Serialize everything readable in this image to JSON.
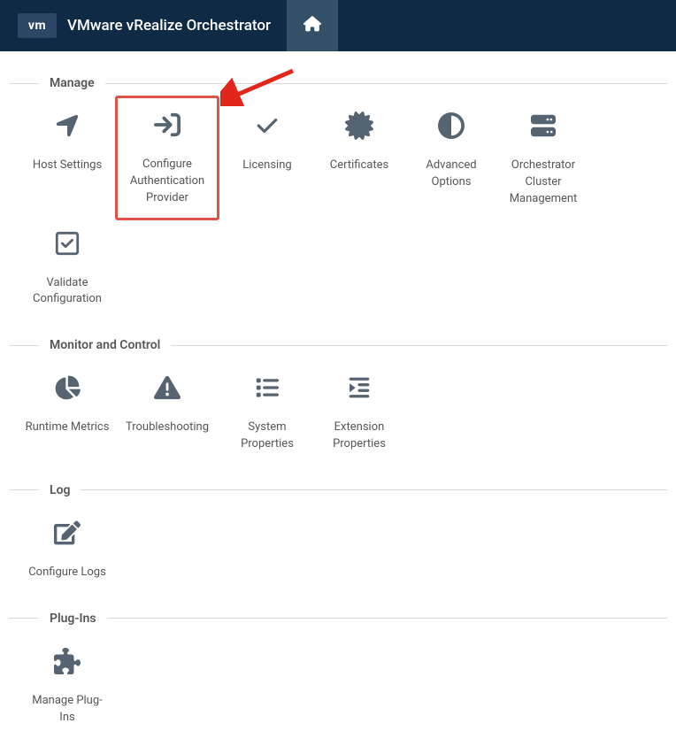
{
  "header": {
    "logo_text": "vm",
    "title": "VMware vRealize Orchestrator"
  },
  "sections": {
    "manage": {
      "title": "Manage",
      "tiles": {
        "host_settings": "Host Settings",
        "config_auth": "Configure Authentication Provider",
        "licensing": "Licensing",
        "certificates": "Certificates",
        "advanced_options": "Advanced Options",
        "orchestrator_cluster": "Orchestrator Cluster Management",
        "validate_config": "Validate Configuration"
      }
    },
    "monitor": {
      "title": "Monitor and Control",
      "tiles": {
        "runtime_metrics": "Runtime Metrics",
        "troubleshooting": "Troubleshooting",
        "system_properties": "System Properties",
        "extension_properties": "Extension Properties"
      }
    },
    "log": {
      "title": "Log",
      "tiles": {
        "configure_logs": "Configure Logs"
      }
    },
    "plugins": {
      "title": "Plug-Ins",
      "tiles": {
        "manage_plugins": "Manage Plug-Ins"
      }
    }
  }
}
